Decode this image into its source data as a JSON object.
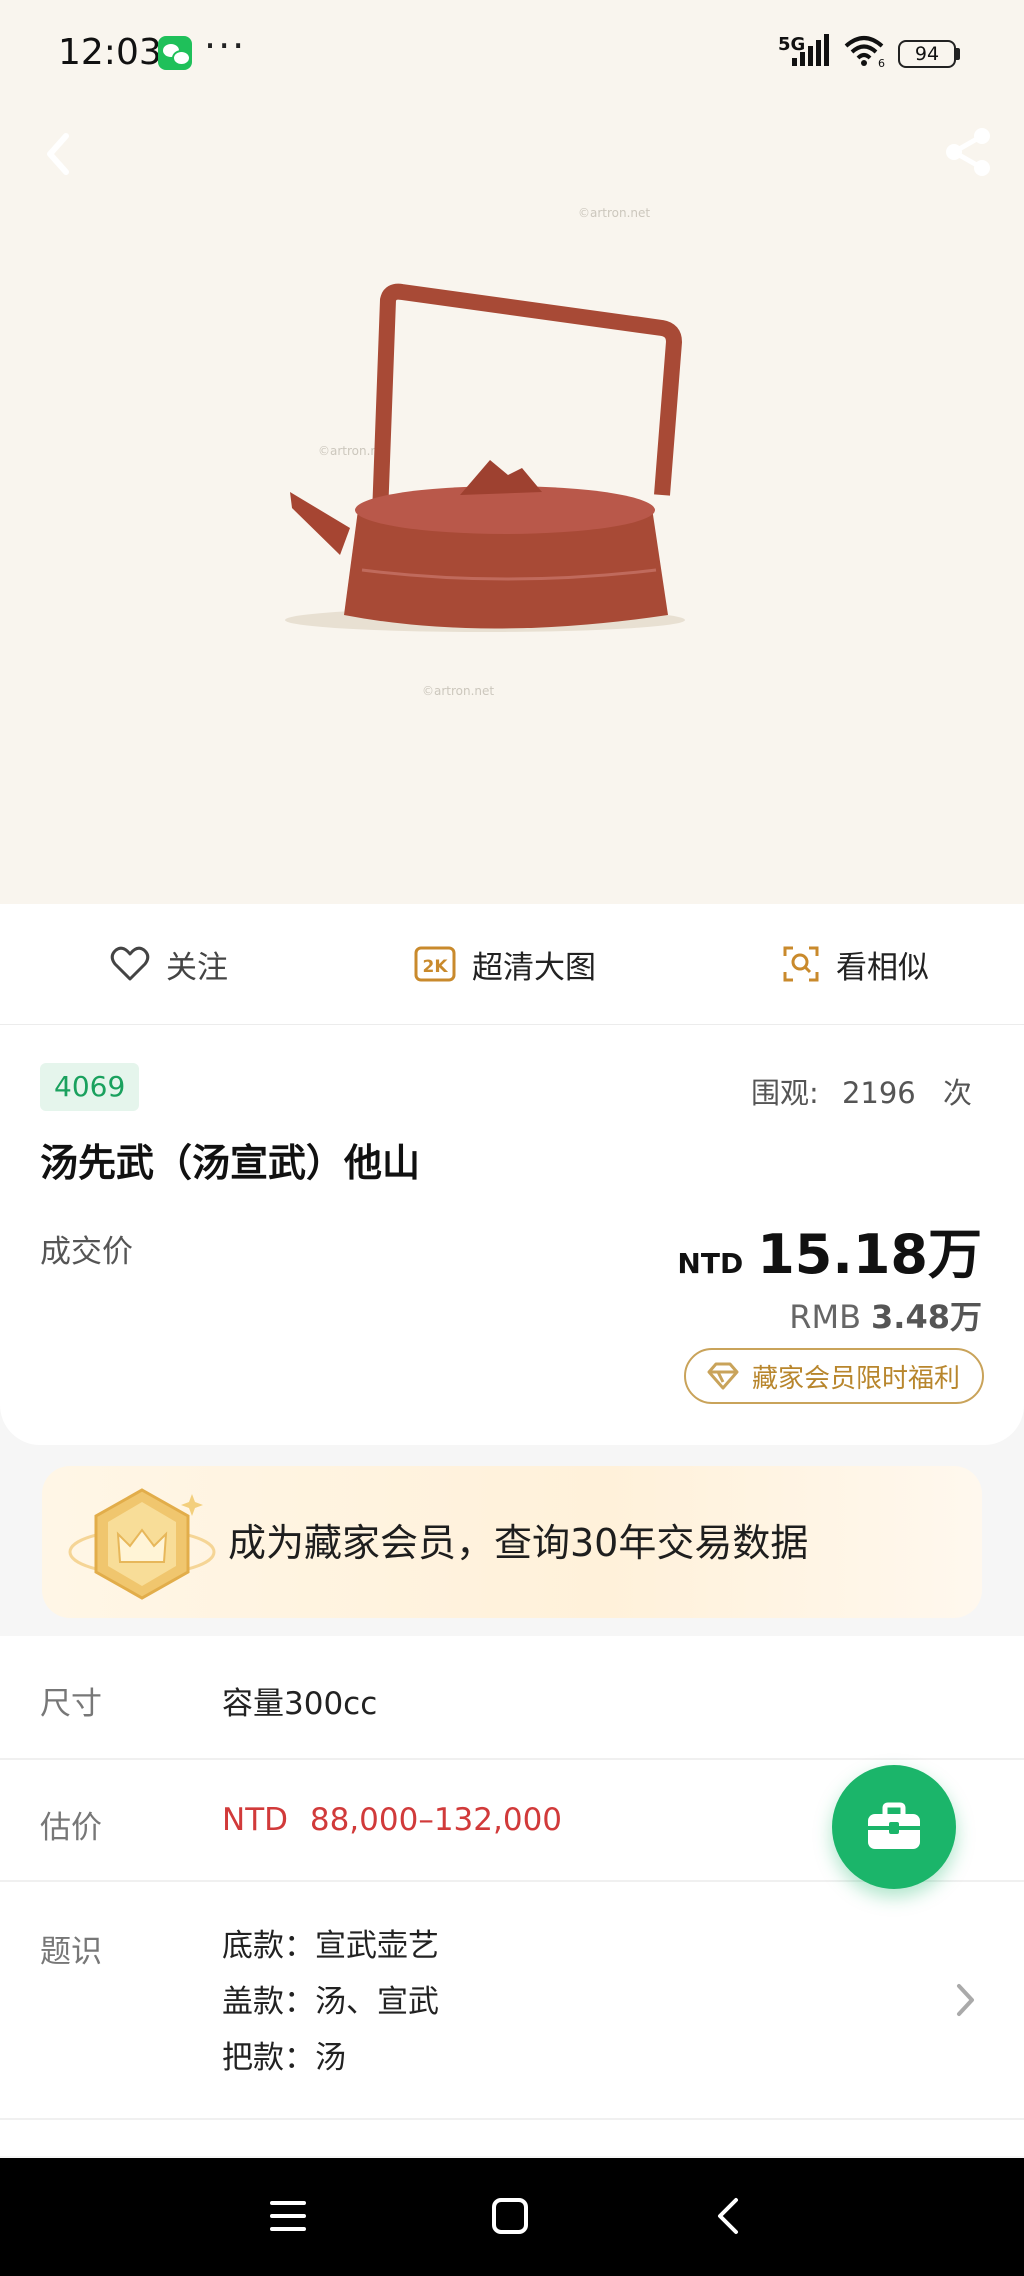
{
  "status_bar": {
    "time": "12:03",
    "dots": "···",
    "network": "5G",
    "wifi_badge": "6",
    "battery": "94"
  },
  "hero": {
    "watermarks": [
      "©artron.net",
      "©artron.net",
      "©artron.net"
    ]
  },
  "actions": {
    "follow_label": "关注",
    "hd_badge": "2K",
    "hd_label": "超清大图",
    "similar_label": "看相似"
  },
  "lot": {
    "number": "4069",
    "views_label": "围观:",
    "views_count": "2196",
    "views_unit": "次",
    "title": "汤先武（汤宣武）他山",
    "deal_label": "成交价",
    "price_currency": "NTD",
    "price_value": "15.18万",
    "rmb_currency": "RMB",
    "rmb_value": "3.48万",
    "vip_label": "藏家会员限时福利"
  },
  "banner": {
    "text": "成为藏家会员，查询30年交易数据"
  },
  "details": {
    "size_label": "尺寸",
    "size_value": "容量300cc",
    "estimate_label": "估价",
    "estimate_currency": "NTD",
    "estimate_value": "88,000–132,000",
    "inscription_label": "题识",
    "inscriptions": [
      "底款：宣武壶艺",
      "盖款：汤、宣武",
      "把款：汤"
    ]
  },
  "colors": {
    "accent_green": "#1bb56a",
    "price_red": "#d13a3a",
    "gold": "#c9a35a",
    "hero_bg": "#f9f5ee"
  },
  "icons": [
    "back-icon",
    "share-icon",
    "heart-icon",
    "hd-2k-icon",
    "image-search-icon",
    "diamond-icon",
    "crown-badge-icon",
    "chevron-right-icon",
    "briefcase-icon",
    "menu-icon",
    "home-icon",
    "nav-back-icon"
  ]
}
